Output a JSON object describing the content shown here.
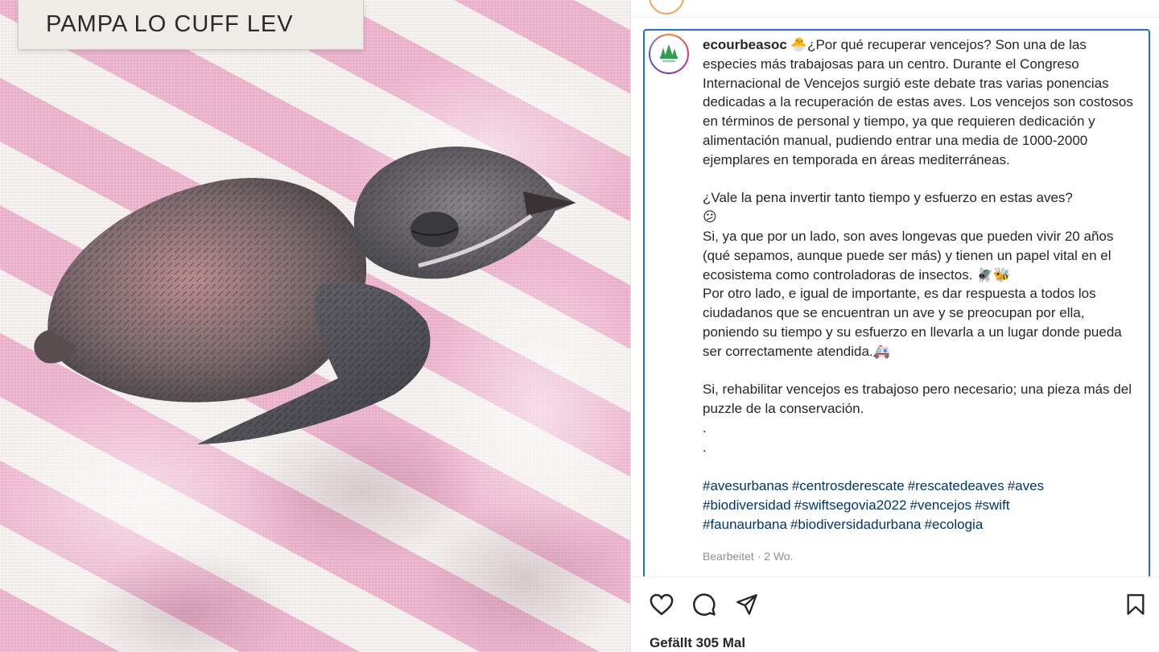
{
  "photo": {
    "box_label": "PAMPA LO CUFF LEV",
    "subject": "bird"
  },
  "post": {
    "username": "ecourbeasoc",
    "caption_emoji_lead": "🐣",
    "caption": "¿Por qué recuperar vencejos? Son una de las especies más trabajosas para un centro. Durante el Congreso Internacional de Vencejos surgió este debate tras varias ponencias dedicadas a la recuperación de estas aves. Los vencejos son costosos en términos de personal y tiempo, ya que requieren dedicación y alimentación manual, pudiendo entrar una media de 1000-2000 ejemplares en temporada en áreas mediterráneas.\n\n¿Vale la pena invertir tanto tiempo y esfuerzo en estas aves?\n😕\nSi, ya que por un lado, son aves longevas que pueden vivir 20 años (qué sepamos, aunque puede ser más) y tienen un papel vital en el ecosistema como controladoras de insectos. 🪰🐝\nPor otro lado, e igual de importante, es dar respuesta a todos los ciudadanos que se encuentran un ave y se preocupan por ella, poniendo su tiempo y su esfuerzo en llevarla a un lugar donde pueda ser correctamente atendida.🚑\n\nSi, rehabilitar vencejos es trabajoso pero necesario; una pieza más del puzzle de la conservación.\n.\n.",
    "hashtags": [
      "#avesurbanas",
      "#centrosderescate",
      "#rescatedeaves",
      "#aves",
      "#biodiversidad",
      "#swiftsegovia2022",
      "#vencejos",
      "#swift",
      "#faunaurbana",
      "#biodiversidadurbana",
      "#ecologia"
    ],
    "timestamp": "Bearbeitet · 2 Wo.",
    "likes": "Gefällt 305 Mal"
  },
  "actions": {
    "like_icon": "heart-icon",
    "comment_icon": "comment-icon",
    "share_icon": "share-icon",
    "save_icon": "bookmark-icon"
  },
  "colors": {
    "hashtag": "#00376b",
    "highlight_border": "#1f6fd6",
    "avatar_green": "#2e9e4f",
    "muted": "#8e8e8e"
  }
}
